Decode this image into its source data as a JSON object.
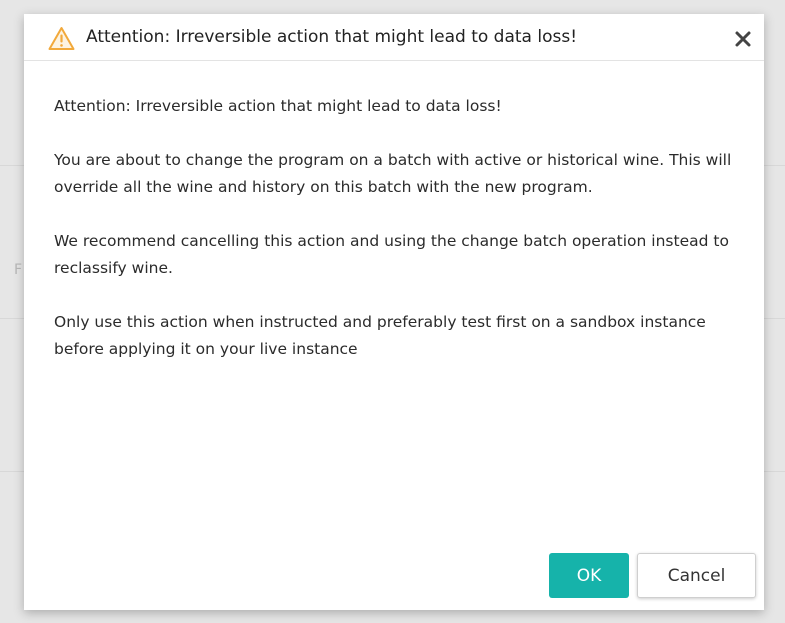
{
  "dialog": {
    "title": "Attention: Irreversible action that might lead to data loss!",
    "title_icon": "warning-triangle-icon",
    "close_icon": "close-icon",
    "paragraphs": [
      "Attention: Irreversible action that might lead to data loss!",
      "You are about to change the program on a batch with active or historical wine. This will override all the wine and history on this batch with the new program.",
      "We recommend cancelling this action and using the change batch operation instead to reclassify wine.",
      "Only use this action when instructed and preferably test first on a sandbox instance before applying it on your live instance"
    ],
    "ok_label": "OK",
    "cancel_label": "Cancel"
  },
  "colors": {
    "accent": "#16b3aa",
    "warning": "#f2a93b"
  }
}
